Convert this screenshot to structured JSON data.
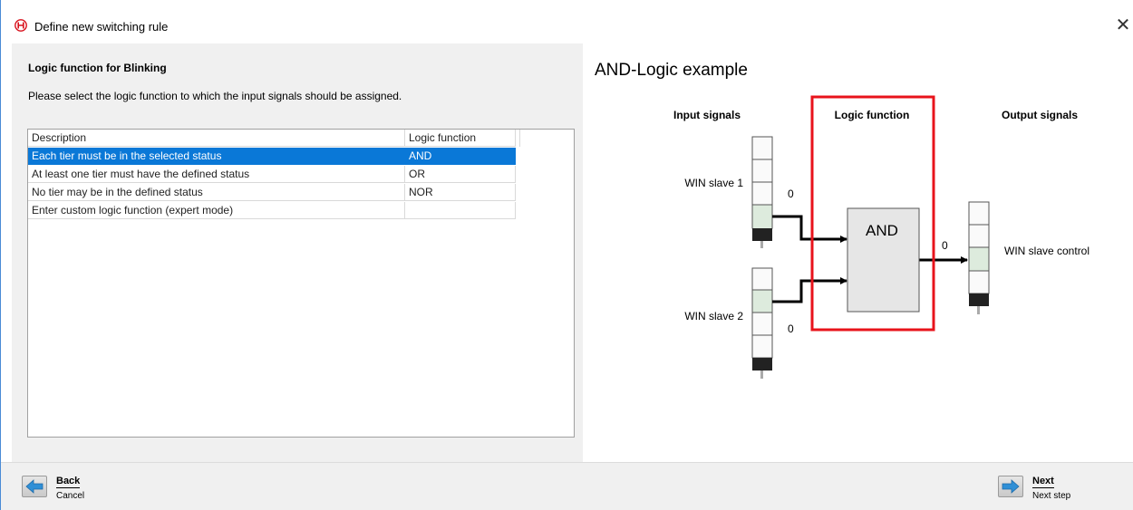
{
  "window": {
    "title": "Define new switching rule",
    "close_symbol": "✕",
    "logo_icon": "werma-logo-icon"
  },
  "left": {
    "heading": "Logic function for Blinking",
    "instruction": "Please select the logic function to which the input signals should be assigned.",
    "table": {
      "columns": [
        "Description",
        "Logic function"
      ],
      "rows": [
        {
          "description": "Each tier must be in the selected status",
          "function": "AND",
          "selected": true
        },
        {
          "description": "At least one tier must have the defined status",
          "function": "OR",
          "selected": false
        },
        {
          "description": "No tier may be in the defined status",
          "function": "NOR",
          "selected": false
        },
        {
          "description": "Enter custom logic function (expert mode)",
          "function": "",
          "selected": false
        }
      ]
    }
  },
  "example": {
    "title": "AND-Logic example",
    "col_input": "Input signals",
    "col_logic": "Logic function",
    "col_output": "Output signals",
    "input1_label": "WIN slave 1",
    "input1_value": "0",
    "input2_label": "WIN slave 2",
    "input2_value": "0",
    "gate_label": "AND",
    "output_value": "0",
    "output_label": "WIN slave control",
    "highlight_color": "#e8131b",
    "gate_fill": "#e6e6e6"
  },
  "footer": {
    "back_label": "Back",
    "cancel_label": "Cancel",
    "next_label": "Next",
    "next_sub": "Next step",
    "back_icon": "arrow-left-icon",
    "next_icon": "arrow-right-icon"
  }
}
